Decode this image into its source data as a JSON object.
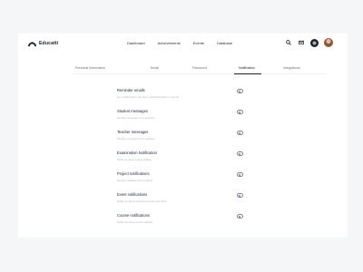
{
  "app": {
    "name": "Educatti"
  },
  "nav": [
    "Dashboard",
    "Achievements",
    "Events",
    "Database"
  ],
  "tabs": [
    {
      "label": "Personal Information"
    },
    {
      "label": "Email"
    },
    {
      "label": "Password"
    },
    {
      "label": "Notification",
      "active": true
    },
    {
      "label": "Integrations"
    }
  ],
  "settings": [
    {
      "title": "Reminder emails",
      "desc": "Get notified when you have unfinished tasks in your list",
      "on": false
    },
    {
      "title": "Student messages",
      "desc": "Receive messages from students",
      "on": false
    },
    {
      "title": "Teacher messages",
      "desc": "Receive messages from teachers",
      "on": false
    },
    {
      "title": "Examination Notification",
      "desc": "Notify me about exam updates",
      "on": false
    },
    {
      "title": "Project notifications",
      "desc": "Receive updates about projects",
      "on": false
    },
    {
      "title": "Event notifications",
      "desc": "Notify me about upcoming events and news",
      "on": false
    },
    {
      "title": "Course notifications",
      "desc": "Notify me about course updates",
      "on": false
    }
  ],
  "icons": {
    "logo": "logo-mark-icon",
    "search": "search-icon",
    "mail": "mail-icon",
    "settings": "gear-icon"
  },
  "colors": {
    "accent": "#1b1f2e",
    "background": "#f5f6f8",
    "muted": "#aeb2bc"
  }
}
